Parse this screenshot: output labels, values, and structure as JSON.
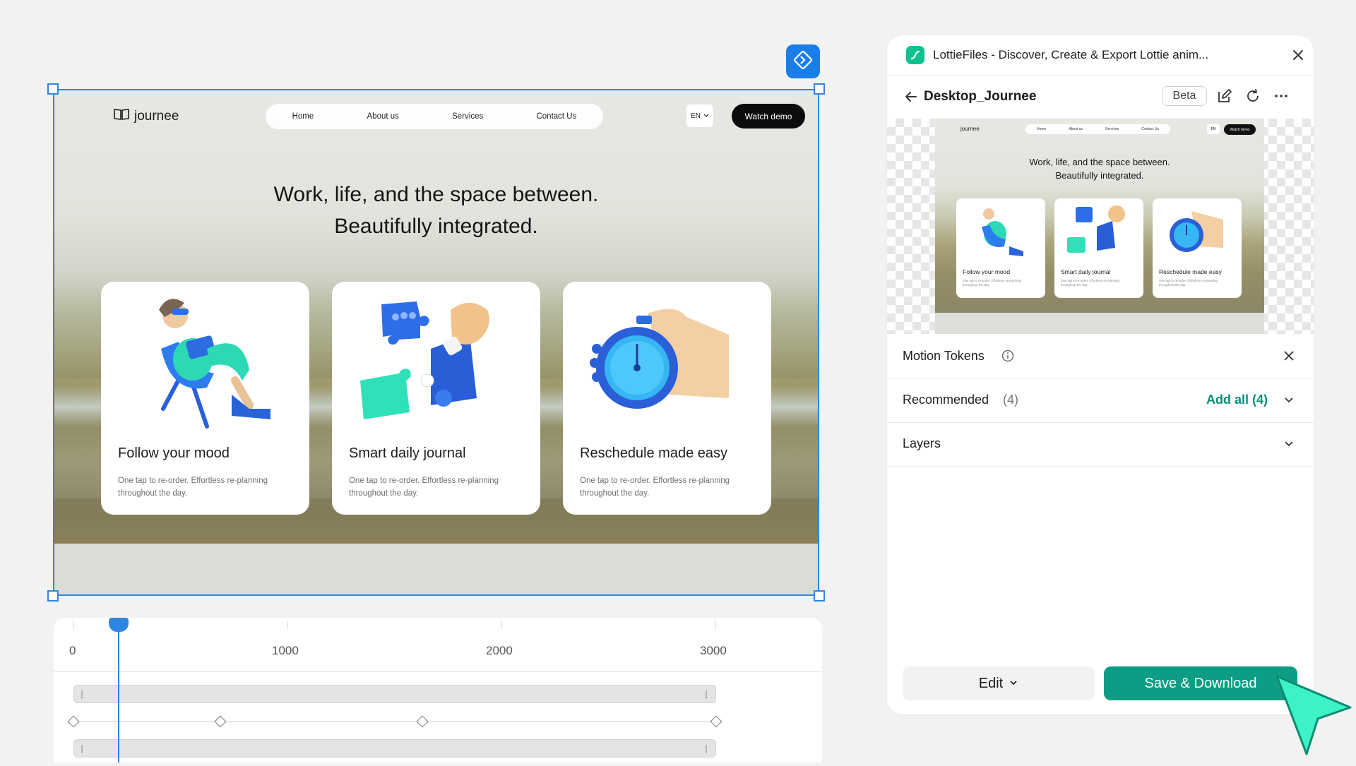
{
  "site": {
    "logo": "journee",
    "nav": [
      "Home",
      "About us",
      "Services",
      "Contact Us"
    ],
    "lang": "EN",
    "cta": "Watch demo",
    "headline_line1": "Work, life, and the space between.",
    "headline_line2": "Beautifully integrated.",
    "cards": [
      {
        "title": "Follow your mood",
        "desc": "One tap to re-order. Effortless re-planning throughout the day."
      },
      {
        "title": "Smart daily journal",
        "desc": "One tap to re-order. Effortless re-planning throughout the day."
      },
      {
        "title": "Reschedule made easy",
        "desc": "One tap to re-order. Effortless re-planning throughout the day."
      }
    ]
  },
  "timeline": {
    "ticks": [
      "0",
      "1000",
      "2000",
      "3000"
    ]
  },
  "panel": {
    "app_title": "LottieFiles - Discover, Create & Export Lottie anim...",
    "file_name": "Desktop_Journee",
    "badge": "Beta",
    "sections": {
      "motion_tokens": "Motion Tokens",
      "recommended": "Recommended",
      "recommended_count": "(4)",
      "add_all": "Add all (4)",
      "layers": "Layers"
    },
    "edit_label": "Edit",
    "save_label": "Save & Download"
  },
  "colors": {
    "accent_blue": "#2f86e0",
    "brand_green": "#0ec290",
    "save_button": "#0c9d84",
    "link_teal": "#0a8f78"
  },
  "icons": [
    "book-icon",
    "chevron-down-icon",
    "diamond-arrow-icon",
    "lottie-logo-icon",
    "close-icon",
    "back-arrow-icon",
    "edit-icon",
    "refresh-icon",
    "more-icon",
    "info-icon",
    "cursor-arrow-icon"
  ]
}
